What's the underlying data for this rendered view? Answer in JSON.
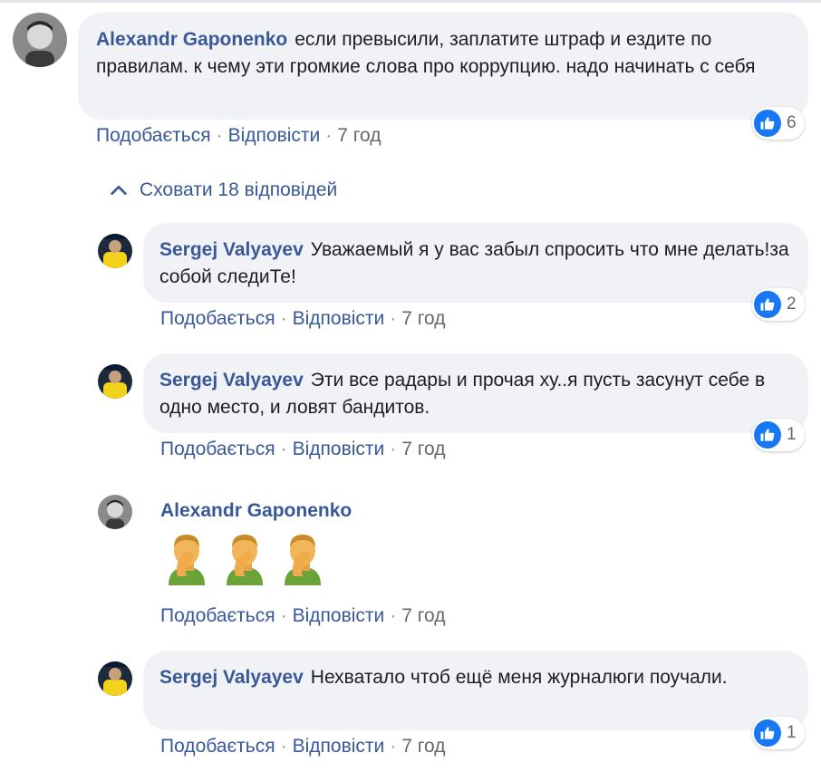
{
  "actions_labels": {
    "like": "Подобається",
    "reply": "Відповісти",
    "separator": "·"
  },
  "hide_replies": {
    "label": "Сховати 18 відповідей",
    "icon": "chevron-up-icon"
  },
  "comments": [
    {
      "author": "Alexandr Gaponenko",
      "text": "если превысили, заплатите штраф и ездите по правилам. к чему эти громкие слова про коррупцию. надо начинать с себя",
      "time": "7 год",
      "reaction_count": "6",
      "reaction_icon": "like-icon"
    },
    {
      "author": "Sergej Valyayev",
      "text": "Уважаемый я у вас забыл спросить что мне делать!за собой следиТе!",
      "time": "7 год",
      "reaction_count": "2",
      "reaction_icon": "like-icon"
    },
    {
      "author": "Sergej Valyayev",
      "text": "Эти все радары и прочая ху..я пусть засунут себе в одно место, и ловят бандитов.",
      "time": "7 год",
      "reaction_count": "1",
      "reaction_icon": "like-icon"
    },
    {
      "author": "Alexandr Gaponenko",
      "text": "",
      "emojis": [
        "man-facepalming-icon",
        "man-facepalming-icon",
        "man-facepalming-icon"
      ],
      "time": "7 год"
    },
    {
      "author": "Sergej Valyayev",
      "text": "Нехватало чтоб ещё меня журналюги поучали.",
      "time": "7 год",
      "reaction_count": "1",
      "reaction_icon": "like-icon"
    }
  ],
  "colors": {
    "link": "#385898",
    "bubble_bg": "#f0f2f5",
    "like_blue": "#1877f2",
    "meta_gray": "#65676b"
  }
}
